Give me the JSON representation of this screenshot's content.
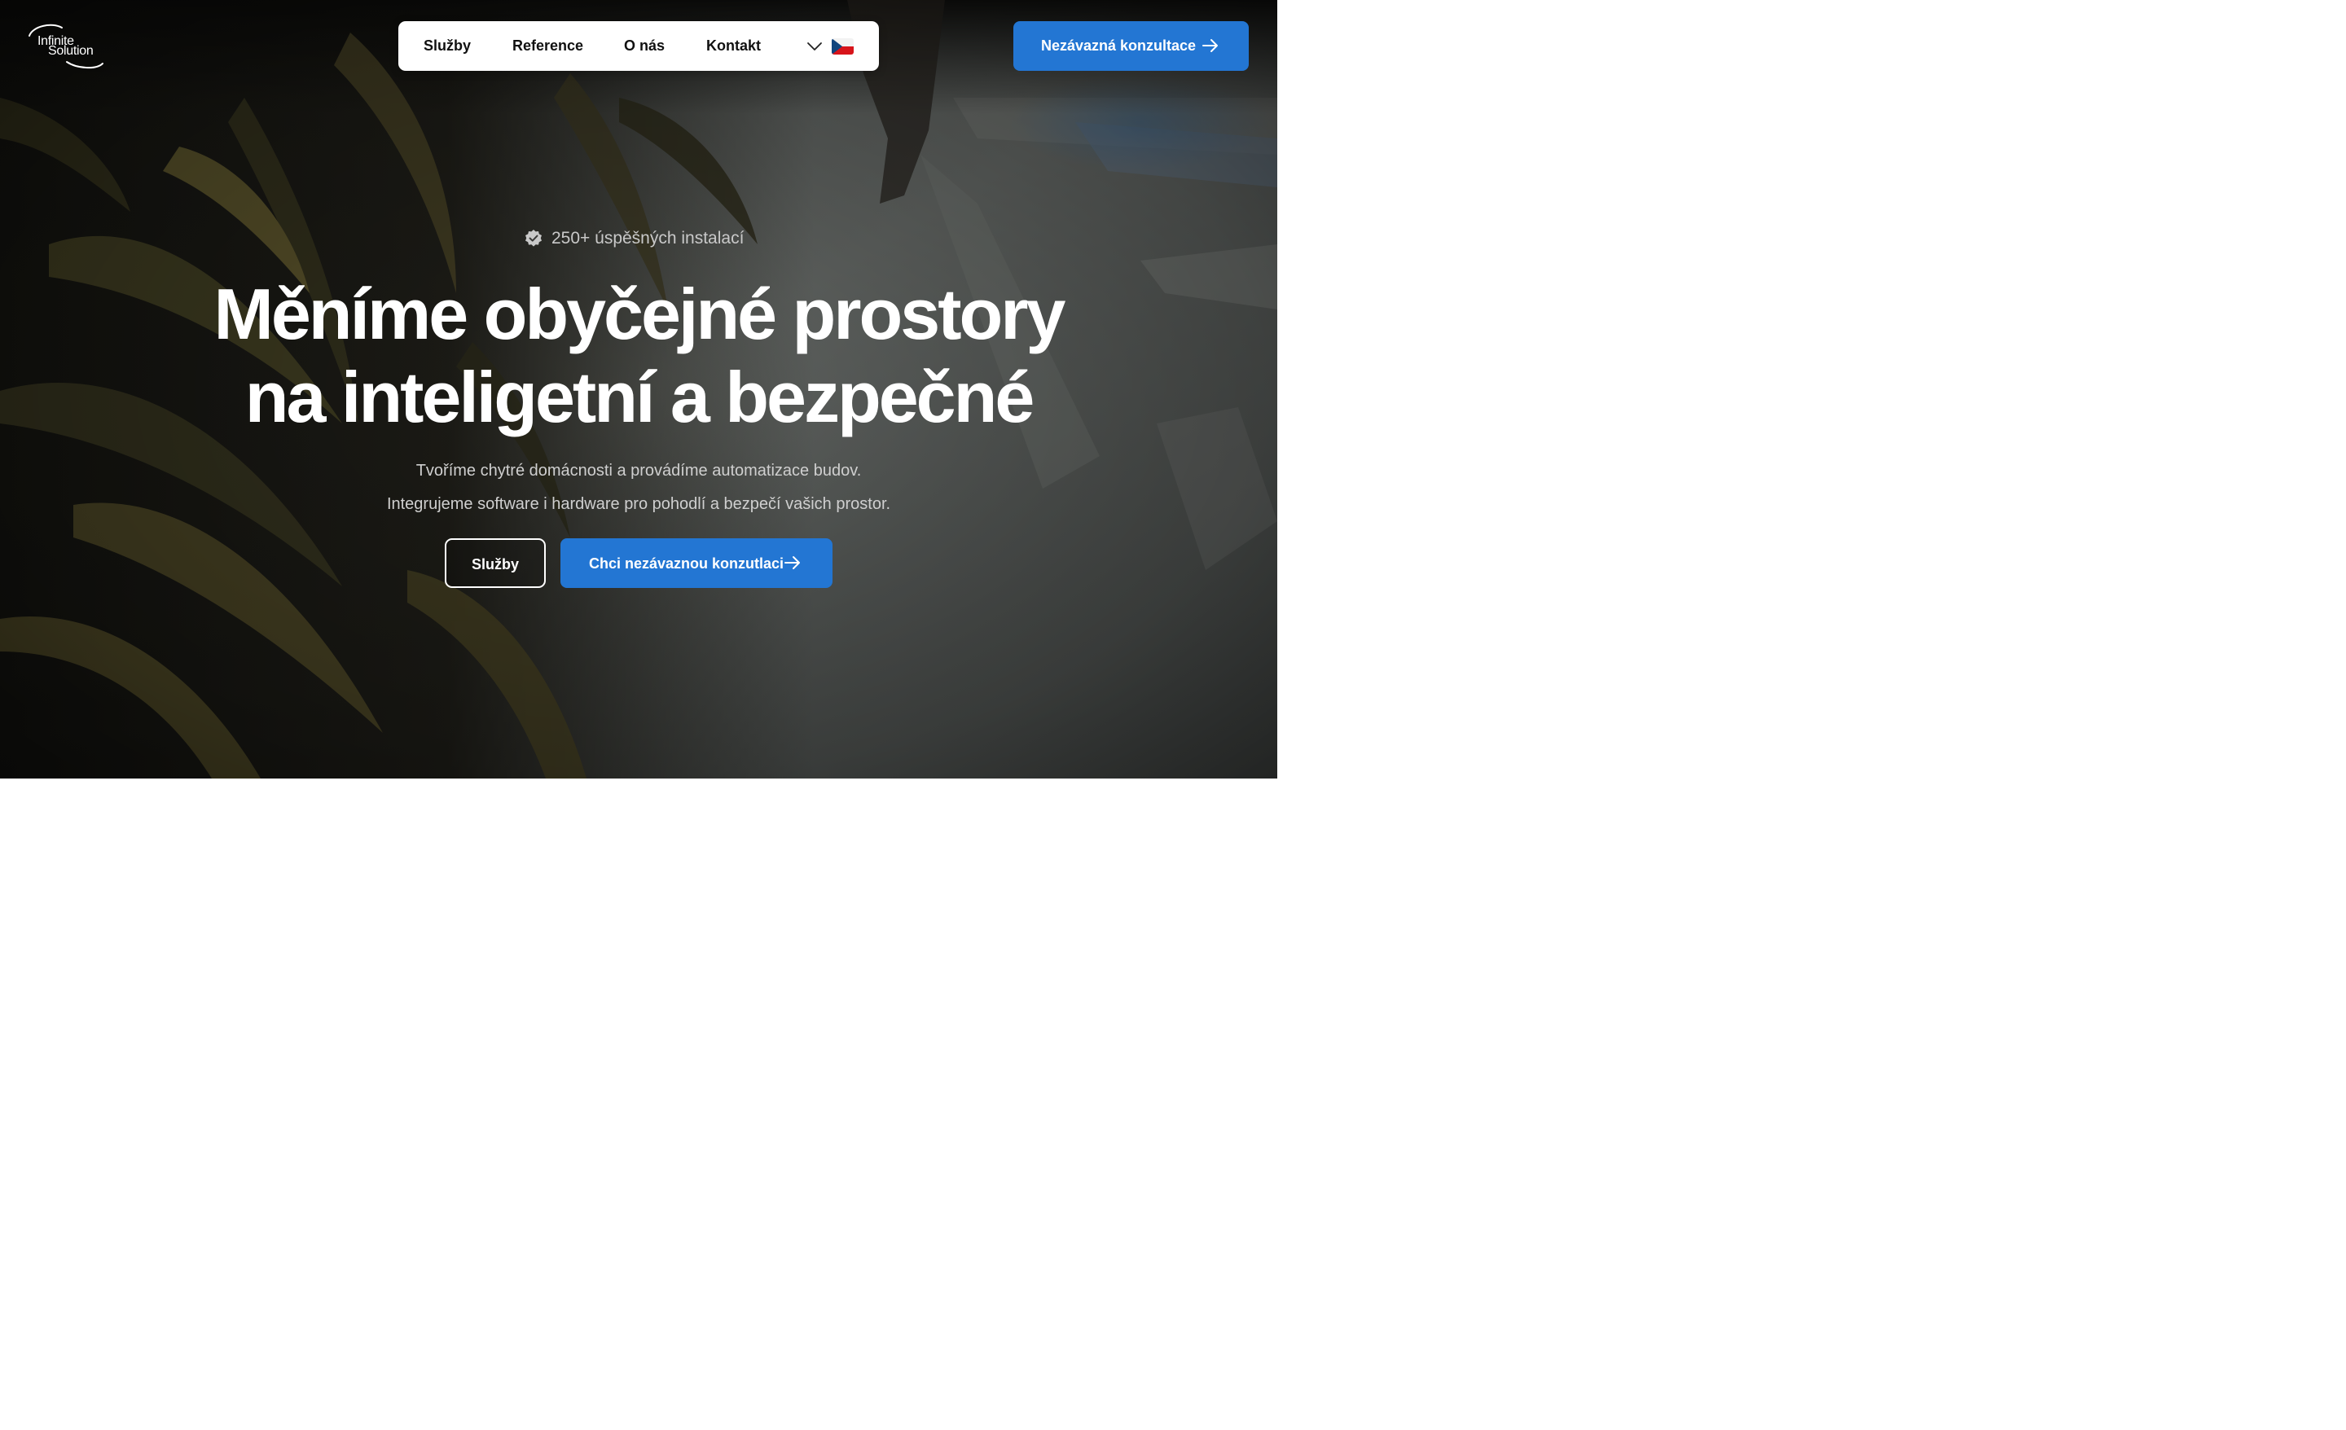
{
  "brand": {
    "logo_line1": "Infinite",
    "logo_line2": "Solution"
  },
  "nav": {
    "items": [
      {
        "label": "Služby"
      },
      {
        "label": "Reference"
      },
      {
        "label": "O nás"
      },
      {
        "label": "Kontakt"
      }
    ],
    "language": {
      "selected": "CZ",
      "icon": "czech-flag-icon"
    }
  },
  "header_cta": {
    "label": "Nezávazná konzultace",
    "icon": "arrow-right-icon"
  },
  "hero": {
    "badge": {
      "icon": "verified-check-icon",
      "text": "250+ úspěšných instalací"
    },
    "headline_line1": "Měníme obyčejné prostory",
    "headline_line2": "na inteligetní a bezpečné",
    "subtitle_line1": "Tvoříme chytré domácnosti a provádíme automatizace budov.",
    "subtitle_line2": "Integrujeme software i hardware pro pohodlí a bezpečí vašich prostor.",
    "secondary_button": "Služby",
    "primary_button": "Chci nezávaznou konzutlaci"
  },
  "colors": {
    "accent": "#2376d3",
    "nav_bg": "#ffffff",
    "text_light": "#ffffff"
  }
}
